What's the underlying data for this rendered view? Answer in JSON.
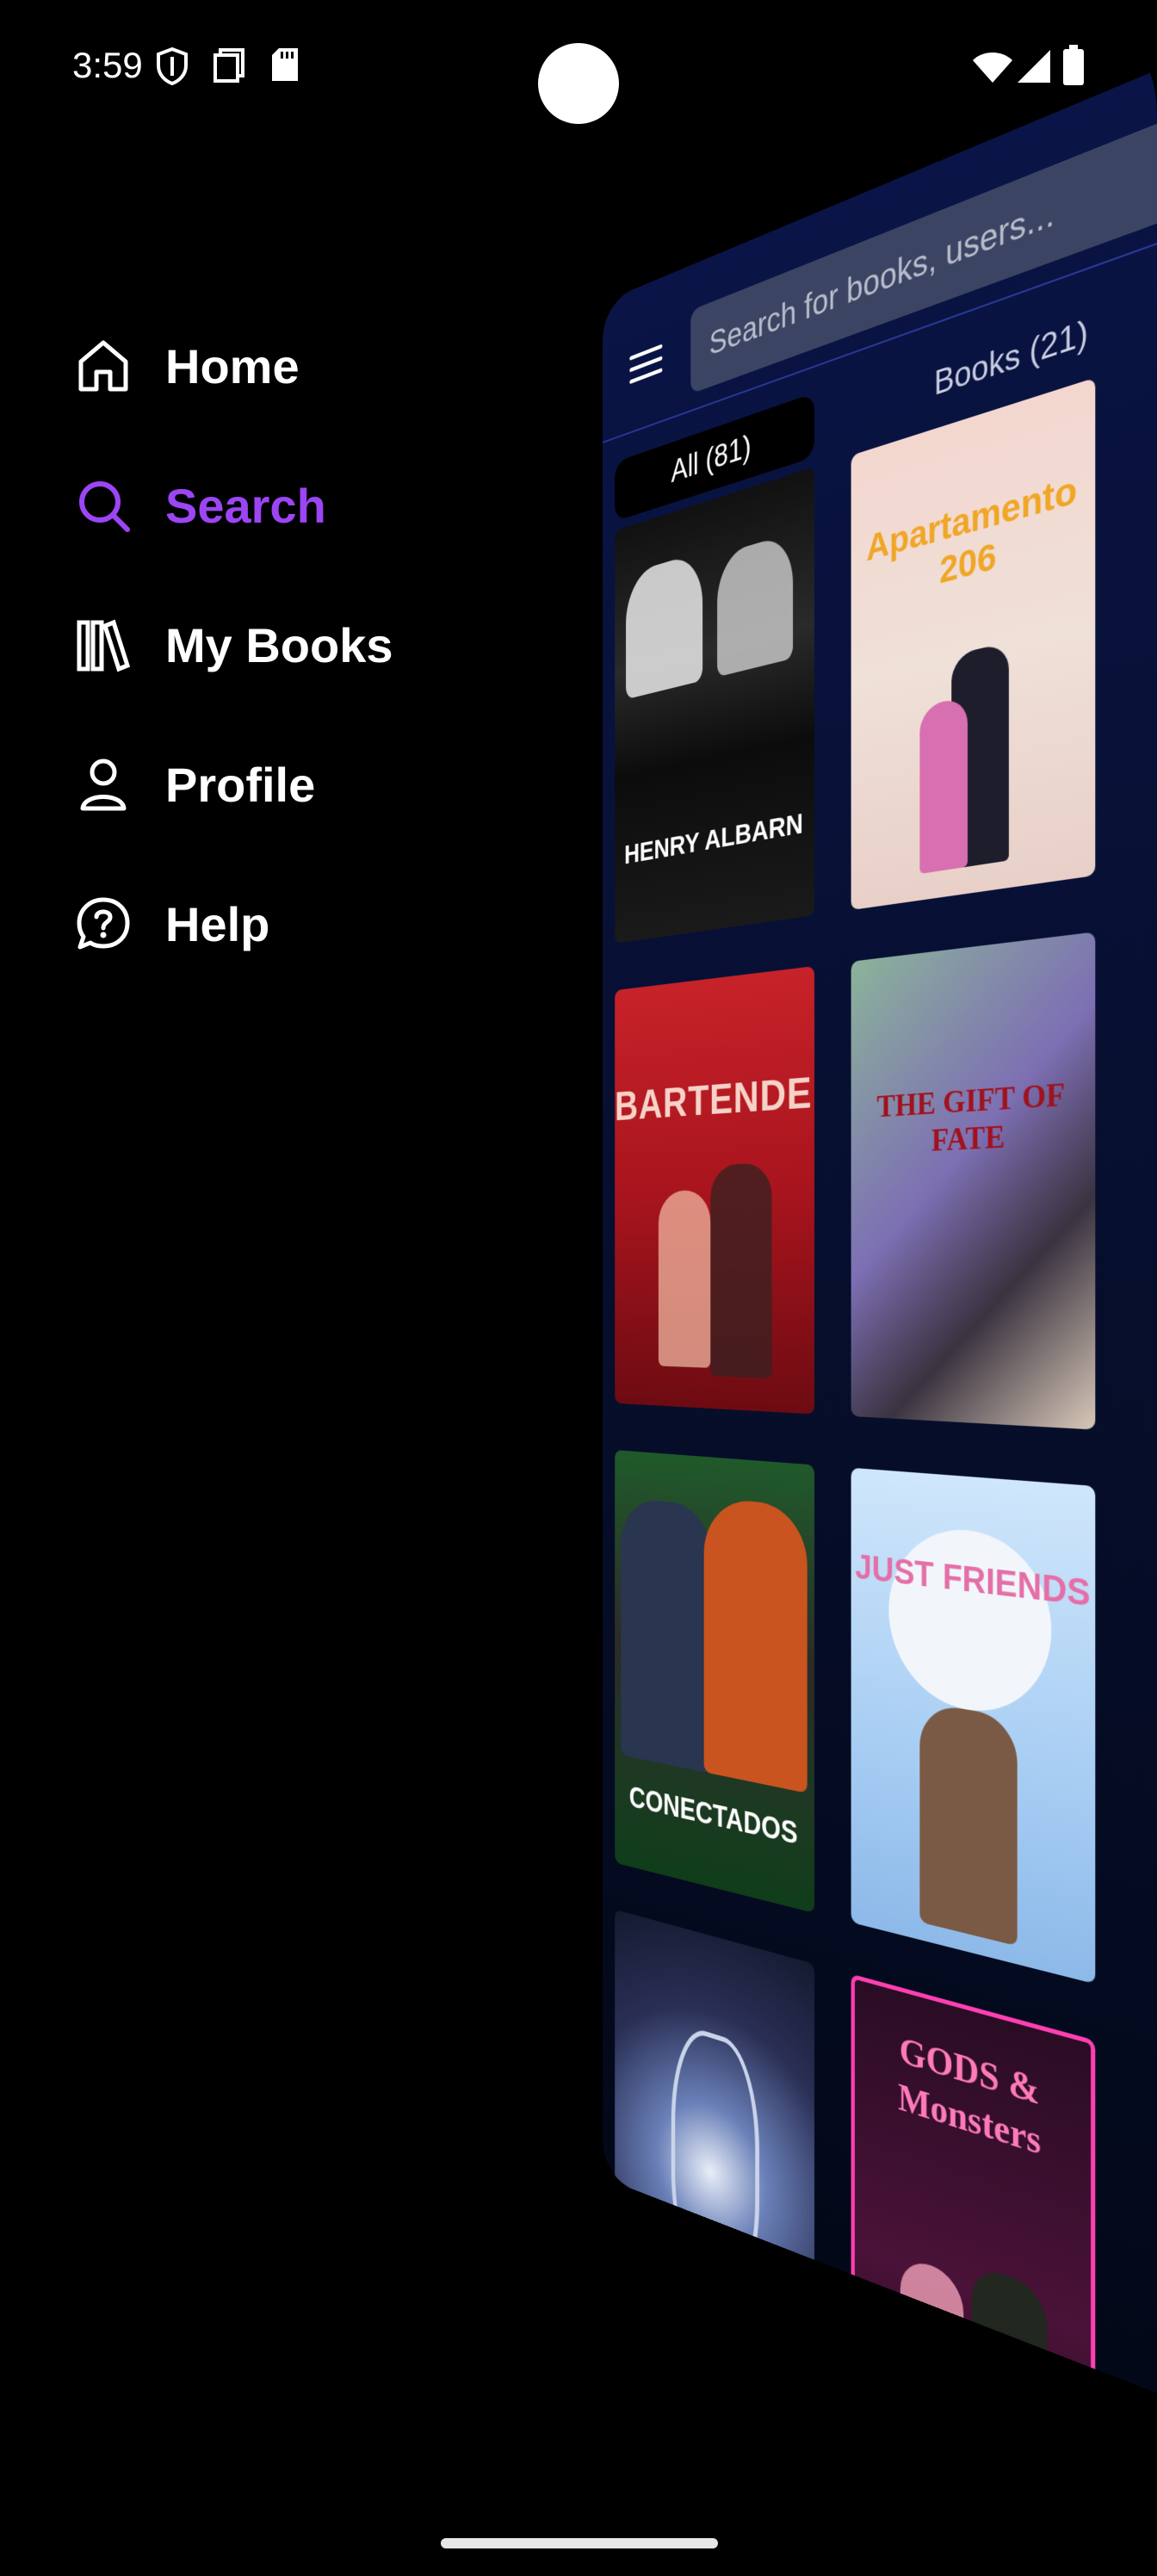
{
  "status_bar": {
    "time": "3:59",
    "icons": [
      "shield-icon",
      "copy-icon",
      "sd-card-icon",
      "wifi-icon",
      "signal-icon",
      "battery-icon"
    ]
  },
  "drawer": {
    "items": [
      {
        "label": "Home",
        "icon": "home-icon",
        "active": false
      },
      {
        "label": "Search",
        "icon": "search-icon",
        "active": true
      },
      {
        "label": "My Books",
        "icon": "books-icon",
        "active": false
      },
      {
        "label": "Profile",
        "icon": "person-icon",
        "active": false
      },
      {
        "label": "Help",
        "icon": "help-icon",
        "active": false
      }
    ],
    "active_color": "#9b45f4"
  },
  "app": {
    "search": {
      "placeholder": "Search for books, users..."
    },
    "tabs": [
      {
        "label": "All (81)",
        "selected": true
      },
      {
        "label": "Books (21)",
        "selected": false
      }
    ],
    "books": [
      {
        "title": "HENRY ALBARN"
      },
      {
        "title": "Apartamento 206"
      },
      {
        "title": "BARTENDER"
      },
      {
        "title": "THE GIFT OF FATE"
      },
      {
        "title": "CONECTADOS"
      },
      {
        "title": "JUST FRIENDS"
      },
      {
        "title": ""
      },
      {
        "title": "GODS & Monsters"
      }
    ]
  }
}
